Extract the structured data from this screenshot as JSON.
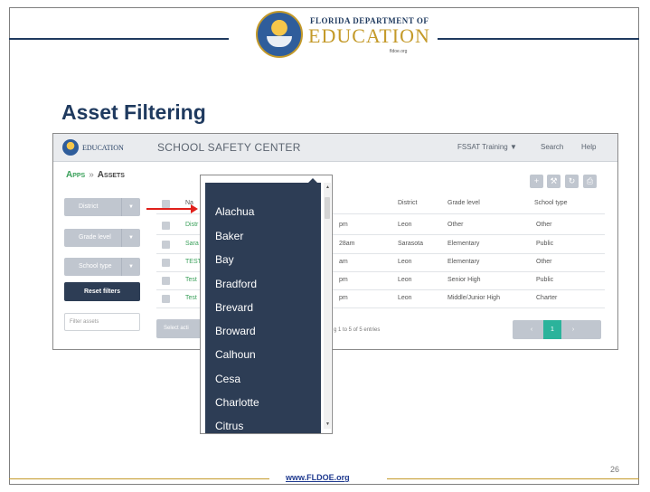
{
  "logo": {
    "top": "FLORIDA DEPARTMENT OF",
    "main": "EDUCATION",
    "url": "fldoe.org"
  },
  "slide_title": "Asset Filtering",
  "app": {
    "logo_text": "EDUCATION",
    "title": "SCHOOL SAFETY CENTER",
    "menu": {
      "training": "FSSAT Training ▼",
      "search": "Search",
      "help": "Help"
    },
    "breadcrumb": {
      "apps": "Apps",
      "sep": "»",
      "assets": "Assets"
    },
    "filters": {
      "district": "District",
      "grade_level": "Grade level",
      "school_type": "School type",
      "arrow": "▼"
    },
    "reset_label": "Reset filters",
    "filter_placeholder": "Filter assets",
    "table": {
      "headers": {
        "name": "Na",
        "district": "District",
        "grade": "Grade level",
        "type": "School type"
      },
      "rows": [
        {
          "name": "Distr",
          "time": "pm",
          "district": "Leon",
          "grade": "Other",
          "type": "Other"
        },
        {
          "name": "Sara",
          "time": "28am",
          "district": "Sarasota",
          "grade": "Elementary",
          "type": "Public"
        },
        {
          "name": "TEST",
          "time": "am",
          "district": "Leon",
          "grade": "Elementary",
          "type": "Other"
        },
        {
          "name": "Test",
          "time": "pm",
          "district": "Leon",
          "grade": "Senior High",
          "type": "Public"
        },
        {
          "name": "Test",
          "time": "pm",
          "district": "Leon",
          "grade": "Middle/Junior High",
          "type": "Charter"
        }
      ]
    },
    "select_action": "Select acti",
    "showing": "g 1 to 5 of 5 entries",
    "pager": {
      "prev": "‹",
      "current": "1",
      "next": "›"
    },
    "tool_icons": [
      "plus-icon",
      "wrench-icon",
      "refresh-icon",
      "print-icon"
    ]
  },
  "dropdown": {
    "items": [
      "Alachua",
      "Baker",
      "Bay",
      "Bradford",
      "Brevard",
      "Broward",
      "Calhoun",
      "Cesa",
      "Charlotte",
      "Citrus"
    ]
  },
  "footer": {
    "url": "www.FLDOE.org",
    "page": "26"
  },
  "colors": {
    "navy": "#1f3a5f",
    "gold": "#c49a2a",
    "dropdown_bg": "#2d3d55",
    "link_green": "#3aa05a",
    "arrow_red": "#e0201b",
    "pager_active": "#2bb39b"
  }
}
